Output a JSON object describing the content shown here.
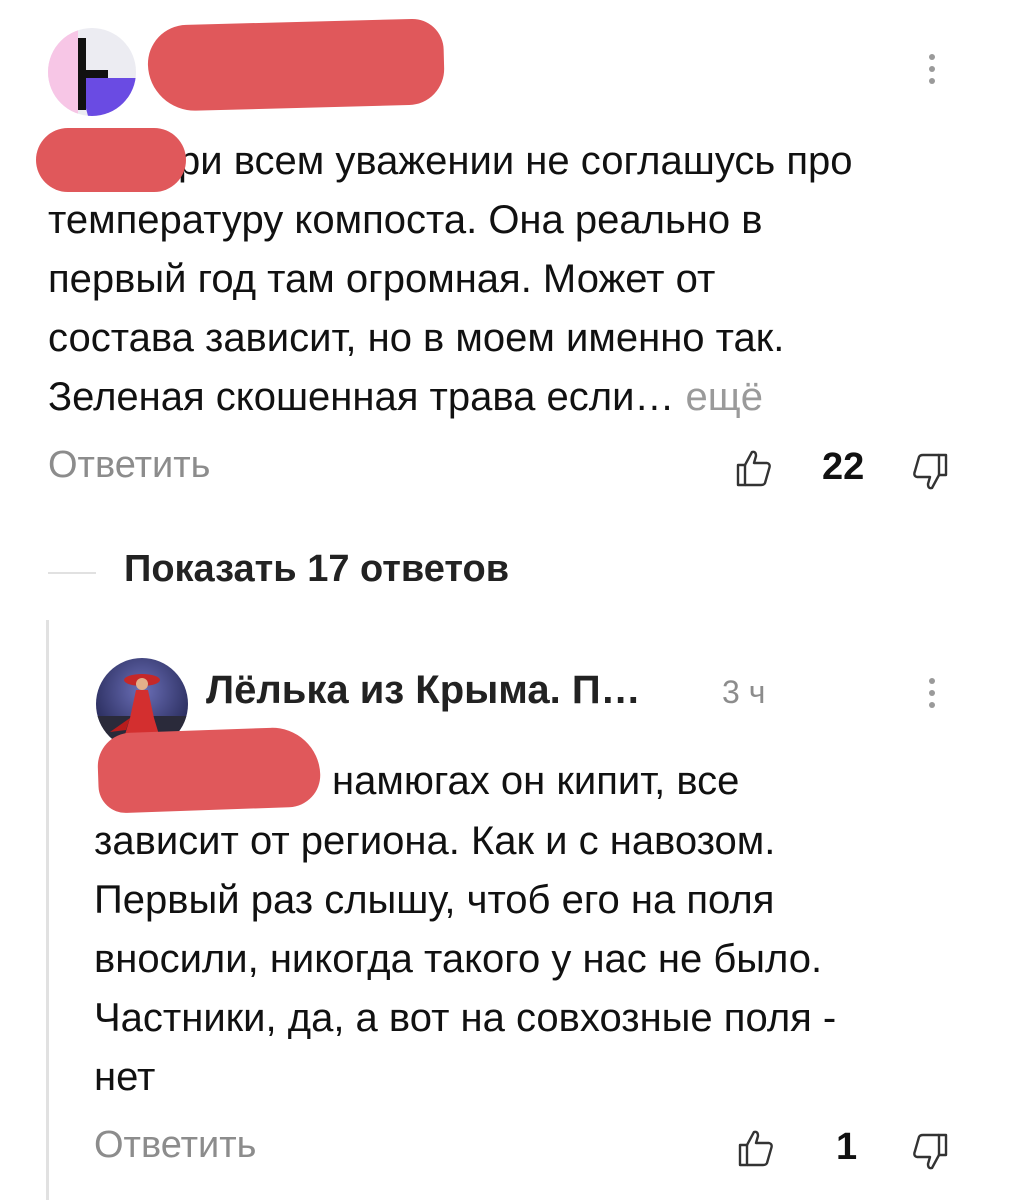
{
  "comment1": {
    "body": "ри всем уважении не соглашусь про\nтемпературу компоста. Она реально в\nпервый год там огромная. Может от\nсостава зависит, но в моем именно так.\nЗеленая скошенная трава если… ",
    "more_label": "ещё",
    "reply_label": "Ответить",
    "likes": "22"
  },
  "show_replies_label": "Показать 17 ответов",
  "comment2": {
    "author": "Лёлька из Крыма. П…",
    "time": "3 ч",
    "first_line": "намюгах он кипит, все",
    "body": "зависит от региона. Как и с навозом.\nПервый раз слышу, чтоб его на поля\nвносили, никогда такого у нас не было.\nЧастники, да, а вот на совхозные поля -\nнет",
    "reply_label": "Ответить",
    "likes": "1"
  },
  "colors": {
    "redaction": "#e0585b",
    "muted": "#8c8c8c",
    "text": "#111111"
  },
  "icons": [
    "kebab-menu-icon",
    "thumbs-up-icon",
    "thumbs-down-icon"
  ]
}
